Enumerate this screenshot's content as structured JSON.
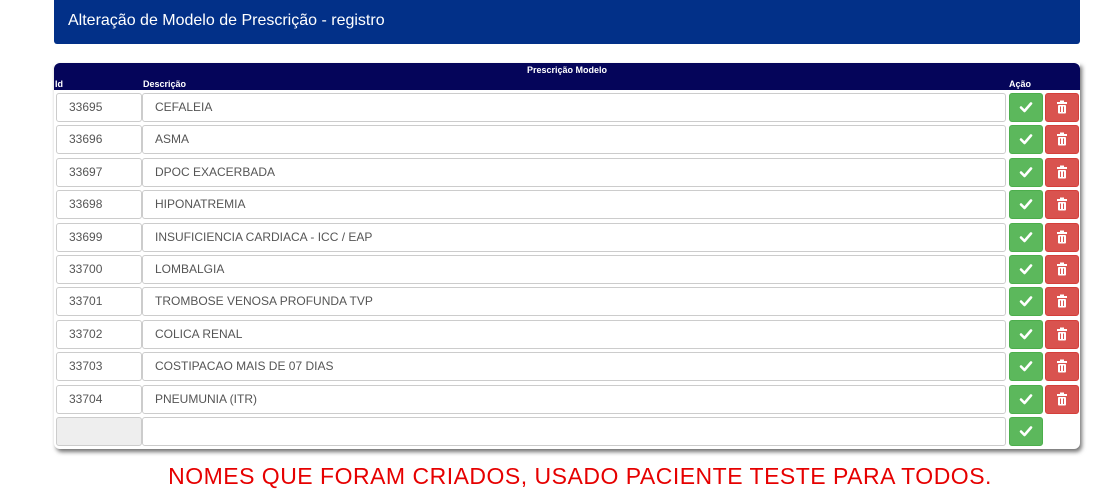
{
  "header": {
    "title": "Alteração de Modelo de Prescrição - registro"
  },
  "table": {
    "caption": "Prescrição Modelo",
    "columns": {
      "id": "Id",
      "description": "Descrição",
      "action": "Ação"
    },
    "rows": [
      {
        "id": "33695",
        "description": "CEFALEIA"
      },
      {
        "id": "33696",
        "description": "ASMA"
      },
      {
        "id": "33697",
        "description": "DPOC EXACERBADA"
      },
      {
        "id": "33698",
        "description": "HIPONATREMIA"
      },
      {
        "id": "33699",
        "description": "INSUFICIENCIA CARDIACA - ICC / EAP"
      },
      {
        "id": "33700",
        "description": "LOMBALGIA"
      },
      {
        "id": "33701",
        "description": "TROMBOSE VENOSA PROFUNDA TVP"
      },
      {
        "id": "33702",
        "description": "COLICA RENAL"
      },
      {
        "id": "33703",
        "description": "COSTIPACAO MAIS DE 07 DIAS"
      },
      {
        "id": "33704",
        "description": "PNEUMUNIA (ITR)"
      }
    ],
    "new_row": {
      "id": "",
      "description": ""
    }
  },
  "annotation": "NOMES QUE FORAM CRIADOS, USADO PACIENTE TESTE PARA TODOS.",
  "icons": {
    "confirm": "check-icon",
    "delete": "trash-icon"
  },
  "colors": {
    "header_bg": "#023088",
    "table_header_bg": "#05055a",
    "confirm_button": "#5cb85c",
    "delete_button": "#d9534f",
    "annotation_text": "#e60000"
  }
}
